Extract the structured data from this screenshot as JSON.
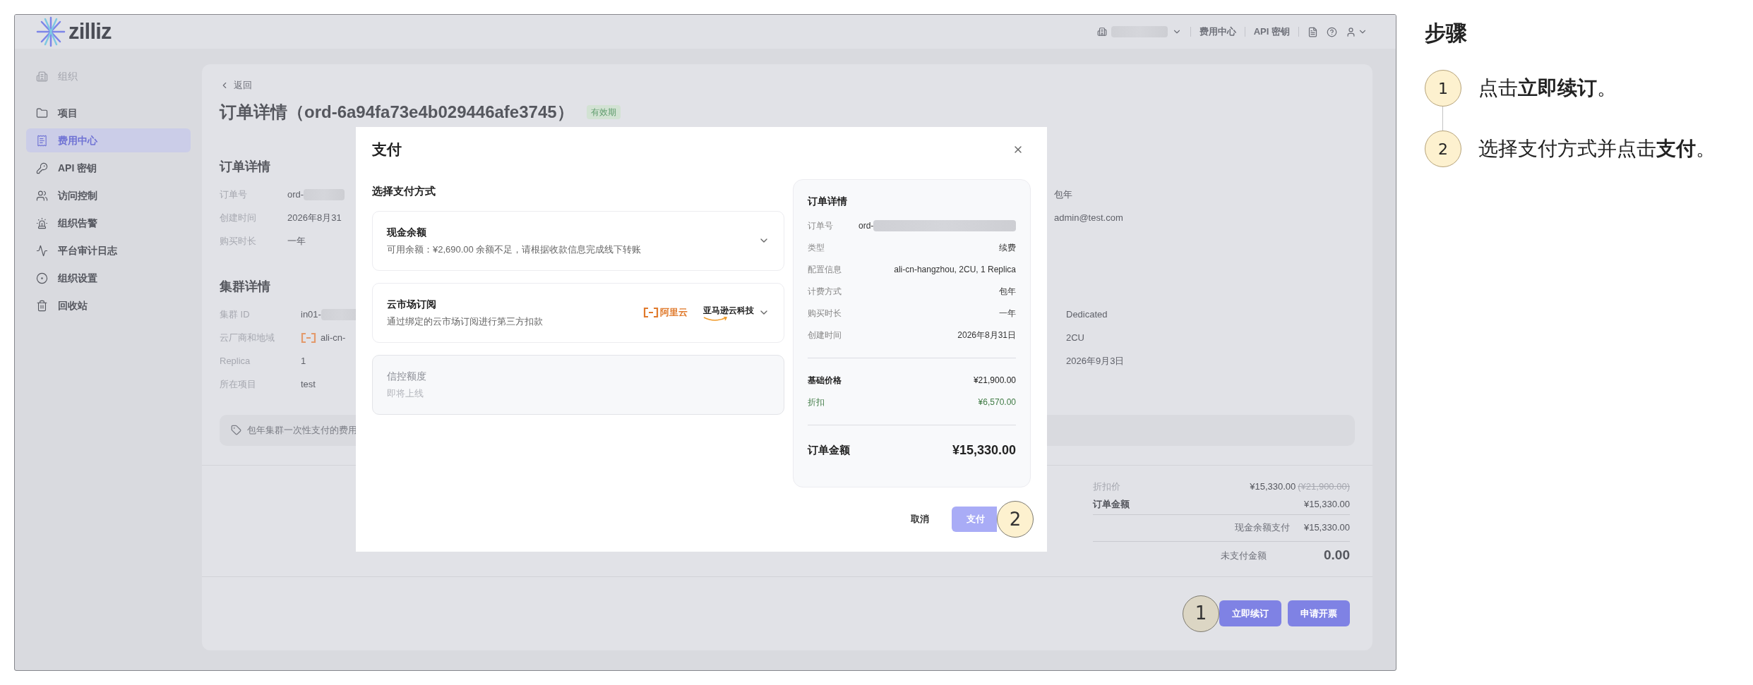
{
  "app": {
    "logo": "zilliz"
  },
  "top_bar": {
    "links": [
      "费用中心",
      "API 密钥"
    ]
  },
  "sidebar": {
    "org_label": "组织",
    "items": [
      {
        "label": "项目",
        "selected": false
      },
      {
        "label": "费用中心",
        "selected": true
      },
      {
        "label": "API 密钥",
        "selected": false
      },
      {
        "label": "访问控制",
        "selected": false
      },
      {
        "label": "组织告警",
        "selected": false
      },
      {
        "label": "平台审计日志",
        "selected": false
      },
      {
        "label": "组织设置",
        "selected": false
      },
      {
        "label": "回收站",
        "selected": false
      }
    ]
  },
  "page": {
    "back": "返回",
    "title": "订单详情（ord-6a94fa73e4b029446afe3745）",
    "status_badge": "有效期",
    "order_section": {
      "heading": "订单详情",
      "rows": [
        {
          "label": "订单号",
          "value": "ord-",
          "redacted": true,
          "side_value": "包年"
        },
        {
          "label": "创建时间",
          "value": "2026年8月31",
          "redacted": false,
          "side_value": "admin@test.com"
        },
        {
          "label": "购买时长",
          "value": "一年",
          "redacted": false
        }
      ]
    },
    "cluster_section": {
      "heading": "集群详情",
      "rows": [
        {
          "label": "集群 ID",
          "value": "in01-",
          "redacted": true,
          "side_value": "Dedicated"
        },
        {
          "label": "云厂商和地域",
          "value": "ali-cn-",
          "redacted": false,
          "provider_logo": true,
          "side_value": "2CU"
        },
        {
          "label": "Replica",
          "value": "1",
          "redacted": false,
          "side_value": "2026年9月3日"
        },
        {
          "label": "所在项目",
          "value": "test",
          "redacted": false
        }
      ]
    },
    "notice": "包年集群一次性支付的费用",
    "summary": [
      {
        "kind": "discount",
        "label": "折扣价",
        "value": "¥15,330.00",
        "strike": "(¥21,900.00)"
      },
      {
        "kind": "total",
        "label": "订单金额",
        "value": "¥15,330.00"
      },
      {
        "kind": "paid",
        "label": "现金余额支付",
        "value": "¥15,330.00"
      },
      {
        "kind": "due",
        "label": "未支付金额",
        "value": "0.00"
      }
    ],
    "marker": "1",
    "actions": [
      "立即续订",
      "申请开票"
    ]
  },
  "modal": {
    "title": "支付",
    "section_label": "选择支付方式",
    "options": [
      {
        "title": "现金余额",
        "description": "可用余额：¥2,690.00 余额不足，请根据收款信息完成线下转账",
        "disabled": false
      },
      {
        "title": "云市场订阅",
        "description": "通过绑定的云市场订阅进行第三方扣款",
        "disabled": false,
        "providers": [
          {
            "kind": "bracket",
            "name": "阿里云"
          },
          {
            "kind": "smile",
            "name": "亚马逊云科技"
          }
        ]
      },
      {
        "title": "信控额度",
        "description": "即将上线",
        "disabled": true
      }
    ],
    "summary": {
      "heading": "订单详情",
      "rows": [
        {
          "label": "订单号",
          "value": "ord-",
          "redacted": true
        },
        {
          "label": "类型",
          "value": "续费",
          "redacted": false
        },
        {
          "label": "配置信息",
          "value": "ali-cn-hangzhou, 2CU, 1 Replica",
          "redacted": false
        },
        {
          "label": "计费方式",
          "value": "包年",
          "redacted": false
        },
        {
          "label": "购买时长",
          "value": "一年",
          "redacted": false
        },
        {
          "label": "创建时间",
          "value": "2026年8月31日",
          "redacted": false
        }
      ],
      "price_rows": [
        {
          "kind": "base",
          "label": "基础价格",
          "value": "¥21,900.00"
        },
        {
          "kind": "discount",
          "label": "折扣",
          "value": "¥6,570.00"
        }
      ],
      "total": {
        "label": "订单金额",
        "value": "¥15,330.00"
      }
    },
    "cancel": "取消",
    "confirm": "支付",
    "marker": "2"
  },
  "steps_panel": {
    "heading": "步骤",
    "steps": [
      {
        "number": "1",
        "text": "点击**立即续订**。"
      },
      {
        "number": "2",
        "text": "选择支付方式并点击**支付**。"
      }
    ]
  }
}
